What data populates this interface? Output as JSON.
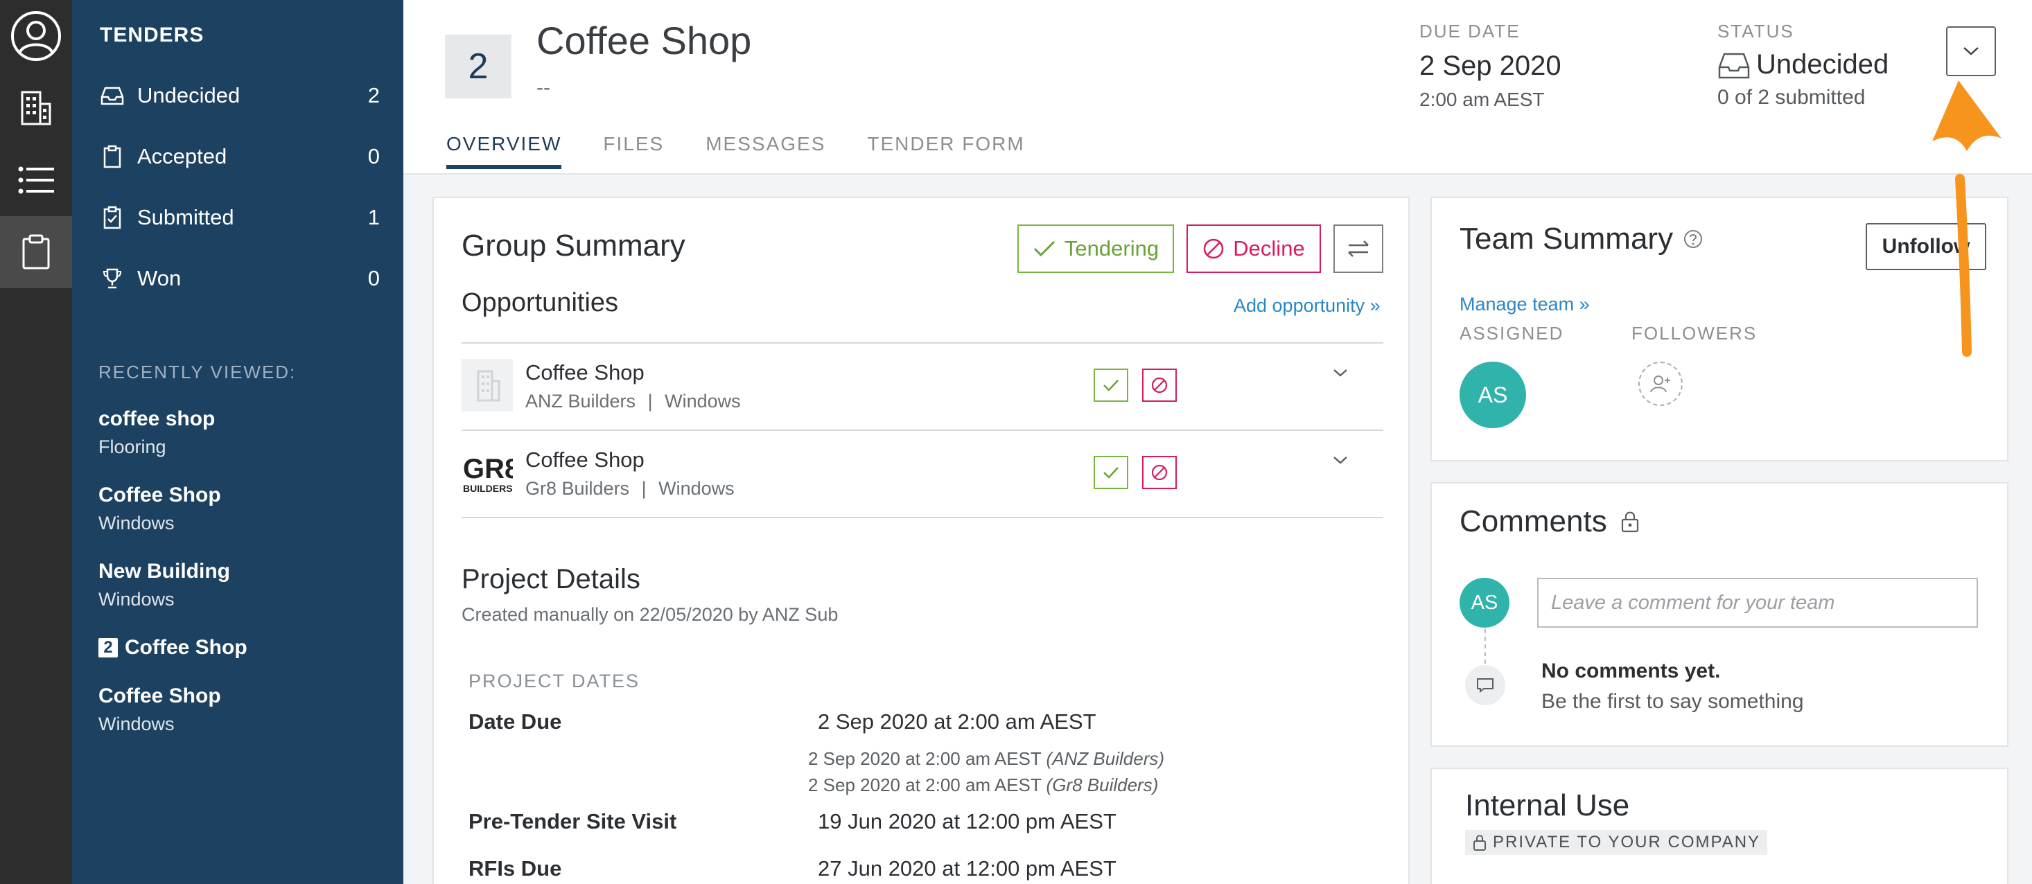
{
  "sidebar": {
    "title": "TENDERS",
    "items": [
      {
        "label": "Undecided",
        "count": "2"
      },
      {
        "label": "Accepted",
        "count": "0"
      },
      {
        "label": "Submitted",
        "count": "1"
      },
      {
        "label": "Won",
        "count": "0"
      }
    ],
    "recent_heading": "RECENTLY VIEWED:",
    "recent": [
      {
        "title": "coffee shop",
        "sub": "Flooring"
      },
      {
        "title": "Coffee Shop",
        "sub": "Windows"
      },
      {
        "title": "New Building",
        "sub": "Windows"
      },
      {
        "badge": "2",
        "title": "Coffee Shop",
        "sub": ""
      },
      {
        "title": "Coffee Shop",
        "sub": "Windows"
      }
    ]
  },
  "header": {
    "badge": "2",
    "title": "Coffee Shop",
    "subtitle": "--",
    "due_label": "DUE DATE",
    "due_date": "2 Sep 2020",
    "due_time": "2:00 am AEST",
    "status_label": "STATUS",
    "status_value": "Undecided",
    "status_sub": "0 of 2 submitted",
    "tabs": [
      "OVERVIEW",
      "FILES",
      "MESSAGES",
      "TENDER FORM"
    ]
  },
  "group": {
    "title": "Group Summary",
    "tendering": "Tendering",
    "decline": "Decline",
    "opportunities_title": "Opportunities",
    "add_opportunity": "Add opportunity »",
    "rows": [
      {
        "name": "Coffee Shop",
        "company": "ANZ Builders",
        "trade": "Windows",
        "sep": "|"
      },
      {
        "name": "Coffee Shop",
        "company": "Gr8 Builders",
        "trade": "Windows",
        "sep": "|"
      }
    ],
    "gr8_logo_text": "GR8",
    "gr8_logo_sub": "BUILDERS"
  },
  "project": {
    "title": "Project Details",
    "created": "Created manually on 22/05/2020 by ANZ Sub",
    "dates_heading": "PROJECT DATES",
    "date_due_label": "Date Due",
    "date_due_value": "2 Sep 2020 at 2:00 am AEST",
    "note1": "2 Sep 2020 at 2:00 am AEST",
    "note1_company": "(ANZ Builders)",
    "note2": "2 Sep 2020 at 2:00 am AEST",
    "note2_company": "(Gr8 Builders)",
    "site_visit_label": "Pre-Tender Site Visit",
    "site_visit_value": "19 Jun 2020 at 12:00 pm AEST",
    "rfi_label": "RFIs Due",
    "rfi_value": "27 Jun 2020 at 12:00 pm AEST"
  },
  "team": {
    "title": "Team Summary",
    "unfollow": "Unfollow",
    "manage": "Manage team »",
    "assigned": "ASSIGNED",
    "followers": "FOLLOWERS",
    "avatar": "AS"
  },
  "comments": {
    "title": "Comments",
    "avatar": "AS",
    "placeholder": "Leave a comment for your team",
    "none": "No comments yet.",
    "first": "Be the first to say something"
  },
  "internal": {
    "title": "Internal Use",
    "private": "PRIVATE TO YOUR COMPANY"
  },
  "colors": {
    "sidebar": "#1d4160",
    "accent_green": "#7cb342",
    "accent_red": "#d81b60",
    "link": "#2b86c4",
    "avatar": "#2fb3ab",
    "arrow": "#f7941d"
  }
}
